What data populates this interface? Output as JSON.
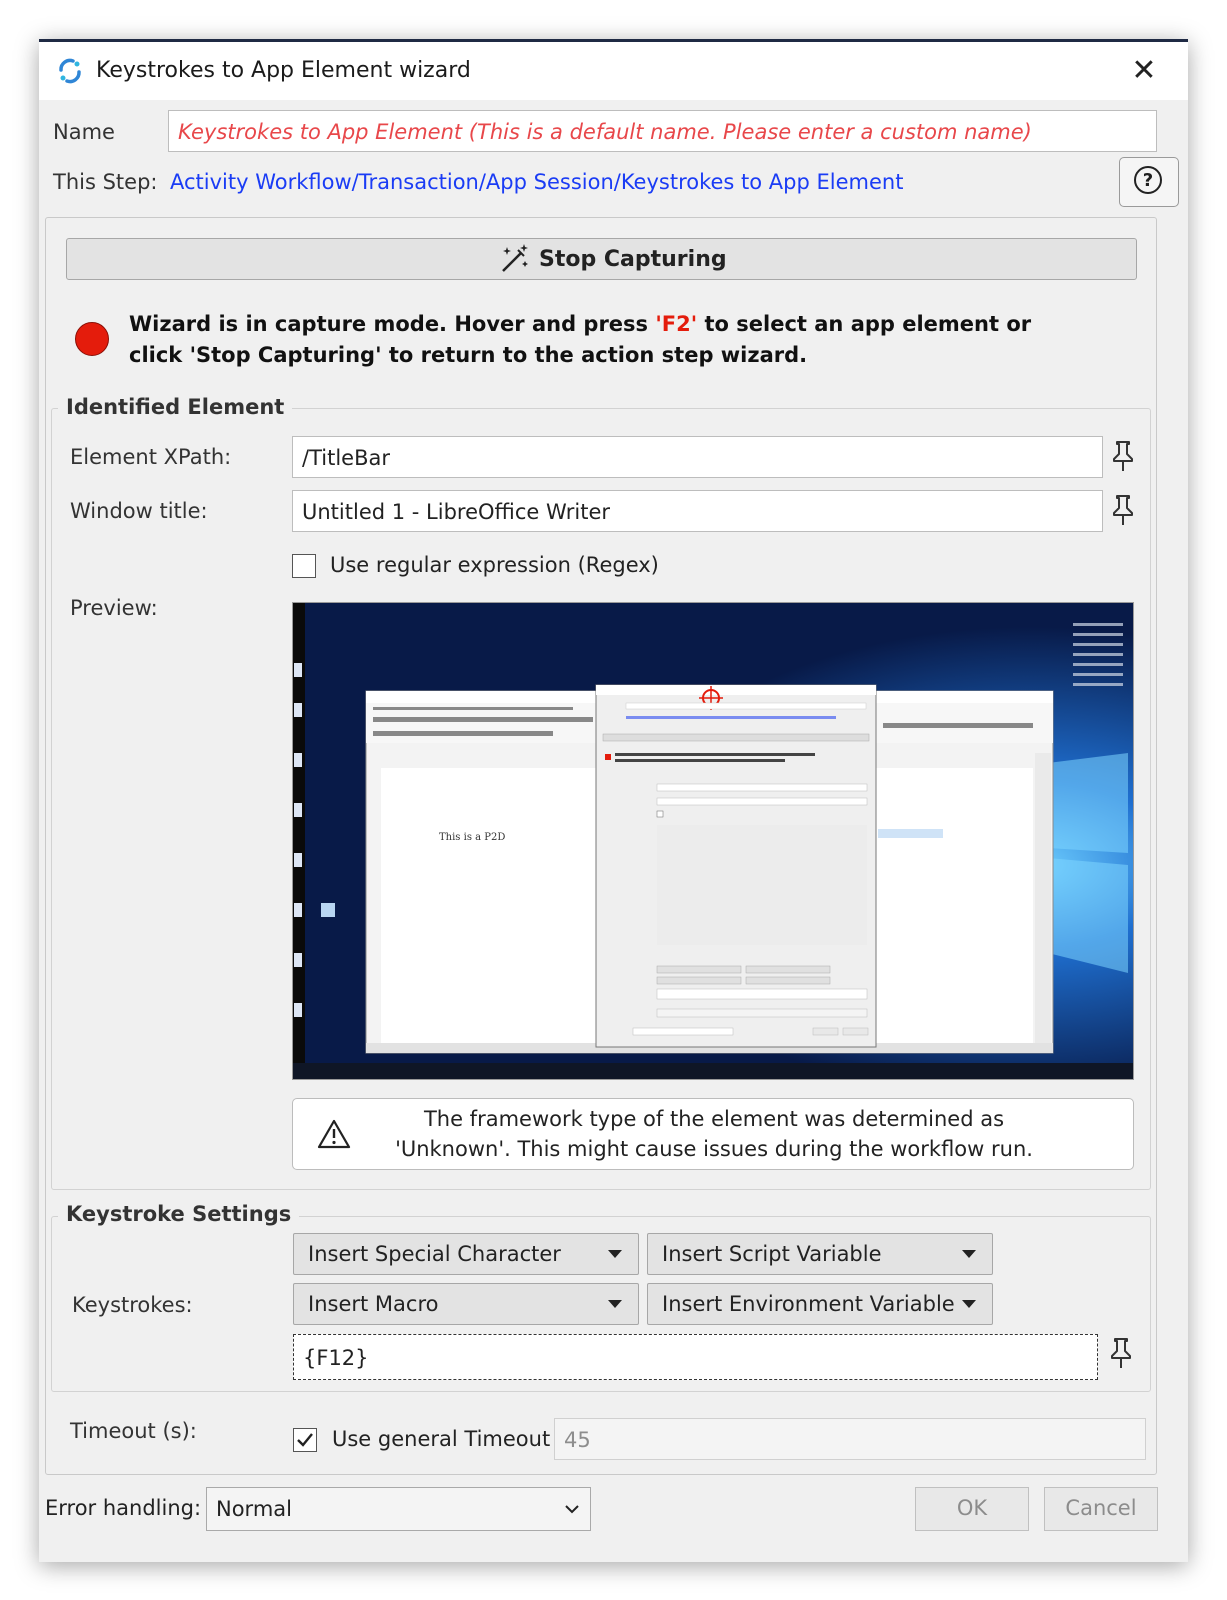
{
  "window": {
    "title": "Keystrokes to App Element wizard",
    "close_icon": "close-icon"
  },
  "name_row": {
    "label": "Name",
    "placeholder": "Keystrokes to App Element  (This is a default name. Please enter a custom name)",
    "placeholder_color": "#e8474a"
  },
  "step_row": {
    "label": "This Step:",
    "path": "Activity Workflow/Transaction/App Session/Keystrokes to App Element",
    "link_color": "#1a3cf5"
  },
  "stop_button": {
    "label": "Stop Capturing",
    "icon": "magic-wand-icon"
  },
  "capture_message": {
    "part1": "Wizard is in capture mode. Hover and press ",
    "key": "'F2'",
    "part2": " to select an app element or",
    "line2": "click 'Stop Capturing' to return to the action step wizard.",
    "indicator_color": "#e41c0c"
  },
  "identified": {
    "title": "Identified Element",
    "xpath_label": "Element XPath:",
    "xpath_value": "/TitleBar",
    "window_label": "Window title:",
    "window_value": "Untitled 1 - LibreOffice Writer",
    "regex_label": "Use regular expression (Regex)",
    "regex_checked": false,
    "preview_label": "Preview:",
    "preview_doc_text": "This is a P2D",
    "warning_line1": "The framework type of the element was determined as",
    "warning_line2": "'Unknown'. This might cause issues during the workflow run."
  },
  "keystroke": {
    "title": "Keystroke Settings",
    "label": "Keystrokes:",
    "dropdowns": [
      "Insert Special Character",
      "Insert Script Variable",
      "Insert Macro",
      "Insert Environment Variable"
    ],
    "value": "{F12}"
  },
  "timeout": {
    "label": "Timeout (s):",
    "checkbox_label": "Use general Timeout",
    "checked": true,
    "value": "45"
  },
  "footer": {
    "error_label": "Error handling:",
    "error_value": "Normal",
    "ok_label": "OK",
    "cancel_label": "Cancel"
  }
}
